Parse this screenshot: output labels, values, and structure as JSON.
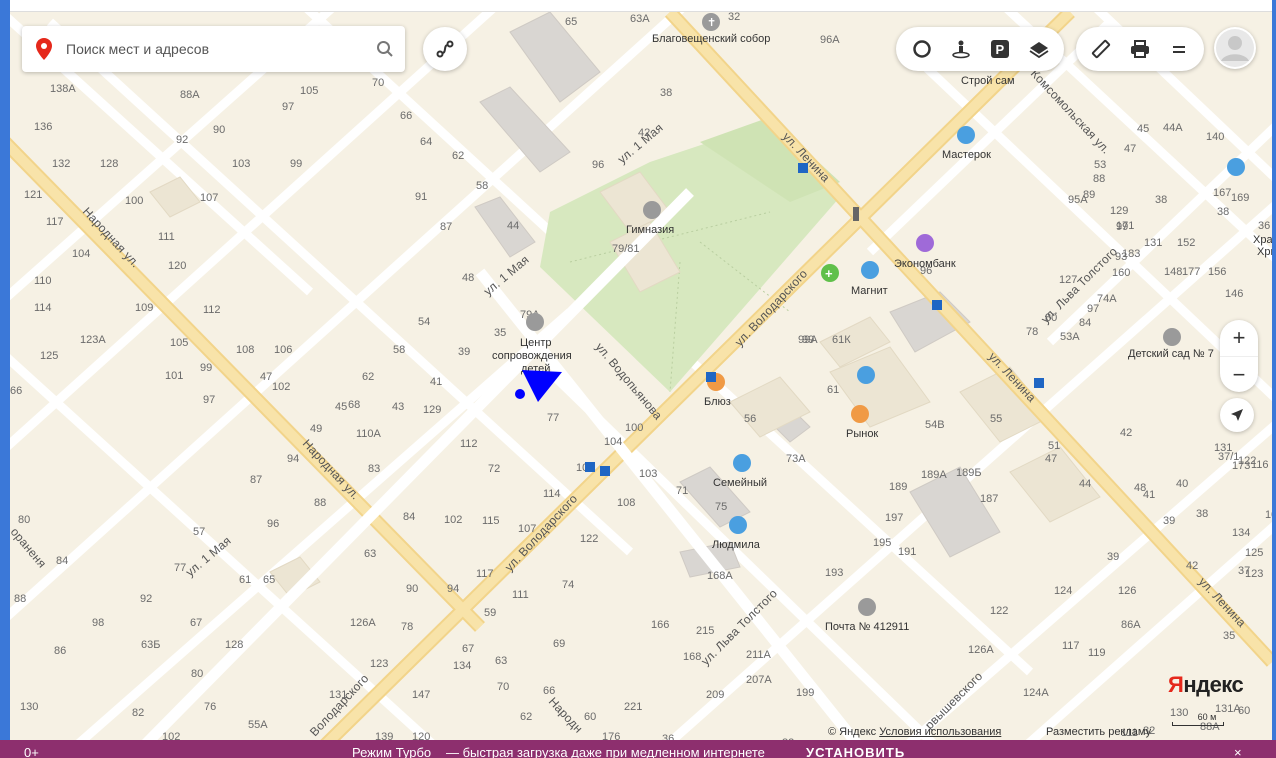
{
  "search": {
    "placeholder": "Поиск мест и адресов"
  },
  "toolbar": {
    "buttons": [
      "traffic-icon",
      "panorama-icon",
      "parking-icon",
      "layers-icon",
      "ruler-icon",
      "print-icon",
      "menu-icon"
    ]
  },
  "zoom": {
    "plus": "+",
    "minus": "−"
  },
  "streets": {
    "lenina_top": "ул. Ленина",
    "lenina_mid": "ул. Ленина",
    "lenina_bottom": "ул. Ленина",
    "volodarskogo_top": "ул. Володарского",
    "volodarskogo_mid": "ул. Володарского",
    "volodarskogo_bottom": "Володарского",
    "narodnaya_top": "Народная ул.",
    "narodnaya_mid": "Народная ул.",
    "narodnaya_bottom": "Народн",
    "maya_top": "ул. 1 Мая",
    "maya_mid": "ул. 1 Мая",
    "maya_left": "ул. 1 Мая",
    "vodopyanova": "ул. Водопьянова",
    "tolstogo_top": "ул. Льва Толстого",
    "tolstogo_bottom": "ул. Льва Толстого",
    "komsomolskaya": "Комсомольская ул.",
    "chkalova": "рвышевского",
    "left_edge": "ораненя"
  },
  "pois": {
    "blagoveshchensky": "Благовещенский собор",
    "stroy": "Строй сам",
    "masterok": "Мастерок",
    "gymnasium": "Гимназия",
    "ekonombank": "Экономбанк",
    "magnit": "Магнит",
    "center": "Центр сопровождения детей",
    "blues": "Блюз",
    "rynok": "Рынок",
    "semeyny": "Семейный",
    "lyudmila": "Людмила",
    "pochta": "Почта № 412911",
    "detsad": "Детский сад № 7",
    "khram": "Храм Р Хри"
  },
  "house_numbers": [
    "65",
    "63А",
    "32",
    "96А",
    "138А",
    "88А",
    "105",
    "97",
    "70",
    "66",
    "136",
    "92",
    "90",
    "103",
    "99",
    "64",
    "62",
    "58",
    "132",
    "128",
    "107",
    "100",
    "91",
    "44",
    "121",
    "117",
    "104",
    "111",
    "87",
    "48",
    "110",
    "114",
    "109",
    "120",
    "112",
    "105",
    "108",
    "106",
    "54",
    "58",
    "47",
    "39",
    "35",
    "125",
    "123А",
    "101",
    "99",
    "102",
    "97",
    "62",
    "41",
    "45",
    "43",
    "129",
    "66",
    "68",
    "49",
    "110А",
    "112",
    "72",
    "87",
    "94",
    "83",
    "88",
    "84",
    "102",
    "80",
    "57",
    "96",
    "84",
    "77",
    "63",
    "61",
    "65",
    "88",
    "92",
    "90",
    "94",
    "98",
    "86",
    "67",
    "63Б",
    "128",
    "126А",
    "78",
    "59",
    "82",
    "80",
    "76",
    "55А",
    "102",
    "130",
    "123",
    "134",
    "131",
    "147",
    "139",
    "120",
    "117",
    "111",
    "74",
    "115",
    "69",
    "67",
    "63",
    "70",
    "66",
    "62",
    "60",
    "176",
    "221",
    "36",
    "38",
    "42",
    "96",
    "79/81",
    "79А",
    "77",
    "100",
    "104",
    "101",
    "103",
    "108",
    "114",
    "107",
    "122",
    "82",
    "56",
    "99",
    "99А",
    "61К",
    "61",
    "54В",
    "73А",
    "75",
    "71",
    "168А",
    "166",
    "168",
    "215",
    "209",
    "211А",
    "207А",
    "199",
    "193",
    "197",
    "195",
    "191",
    "189",
    "189А",
    "189Б",
    "187",
    "55",
    "51",
    "47",
    "44",
    "42",
    "40",
    "38",
    "134",
    "125",
    "123",
    "131А",
    "130",
    "126А",
    "117",
    "119",
    "124А",
    "122",
    "124",
    "126",
    "39",
    "48",
    "41",
    "39",
    "42",
    "35",
    "37",
    "37/1",
    "173",
    "177",
    "152",
    "146",
    "148",
    "156",
    "160",
    "74А",
    "183",
    "171",
    "129",
    "131",
    "127",
    "80",
    "78",
    "53А",
    "84",
    "97",
    "93",
    "99",
    "96",
    "95А",
    "89",
    "88",
    "53",
    "47",
    "45",
    "44А",
    "140",
    "167",
    "169",
    "38",
    "36",
    "38",
    "131",
    "122",
    "116",
    "109",
    "111",
    "86А",
    "82",
    "88А",
    "60",
    "64",
    "68",
    "92",
    "96",
    "94"
  ],
  "copyright": "© Яндекс",
  "terms": "Условия использования",
  "advert": "Разместить рекламу",
  "logo": {
    "ya": "Я",
    "rest": "ндекс"
  },
  "scale": "60 м",
  "turbo": {
    "age": "0+",
    "title": "Режим Турбо",
    "text": "— быстрая загрузка даже при медленном интернете",
    "cta": "УСТАНОВИТЬ",
    "close": "×"
  }
}
